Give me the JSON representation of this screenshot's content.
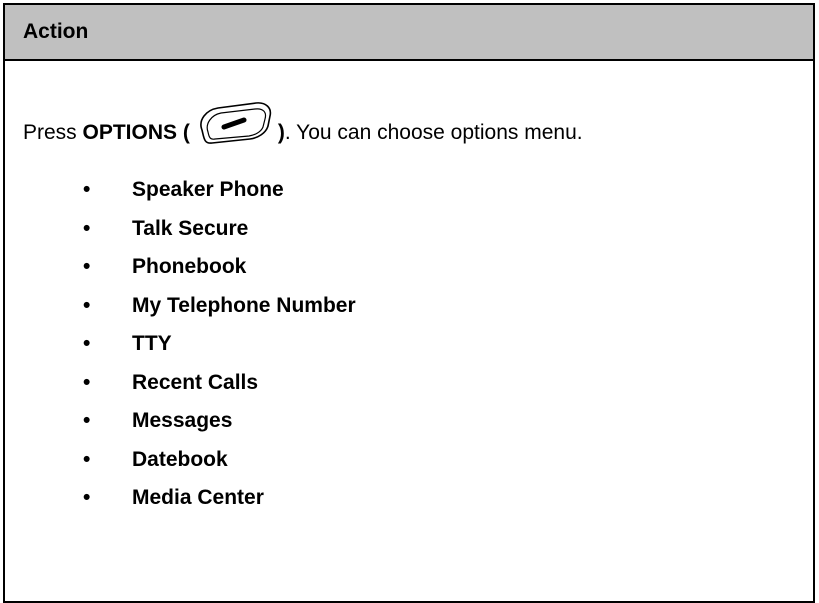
{
  "table": {
    "header": "Action"
  },
  "instruction": {
    "prefix": "Press ",
    "key_name": "OPTIONS (",
    "key_close": ")",
    "suffix": ". You can choose options menu.",
    "key_icon": "options-key-icon"
  },
  "options_menu": {
    "bullet": "•",
    "items": [
      "Speaker Phone",
      "Talk Secure",
      "Phonebook",
      "My Telephone Number",
      "TTY",
      "Recent Calls",
      "Messages",
      "Datebook",
      "Media Center"
    ]
  }
}
